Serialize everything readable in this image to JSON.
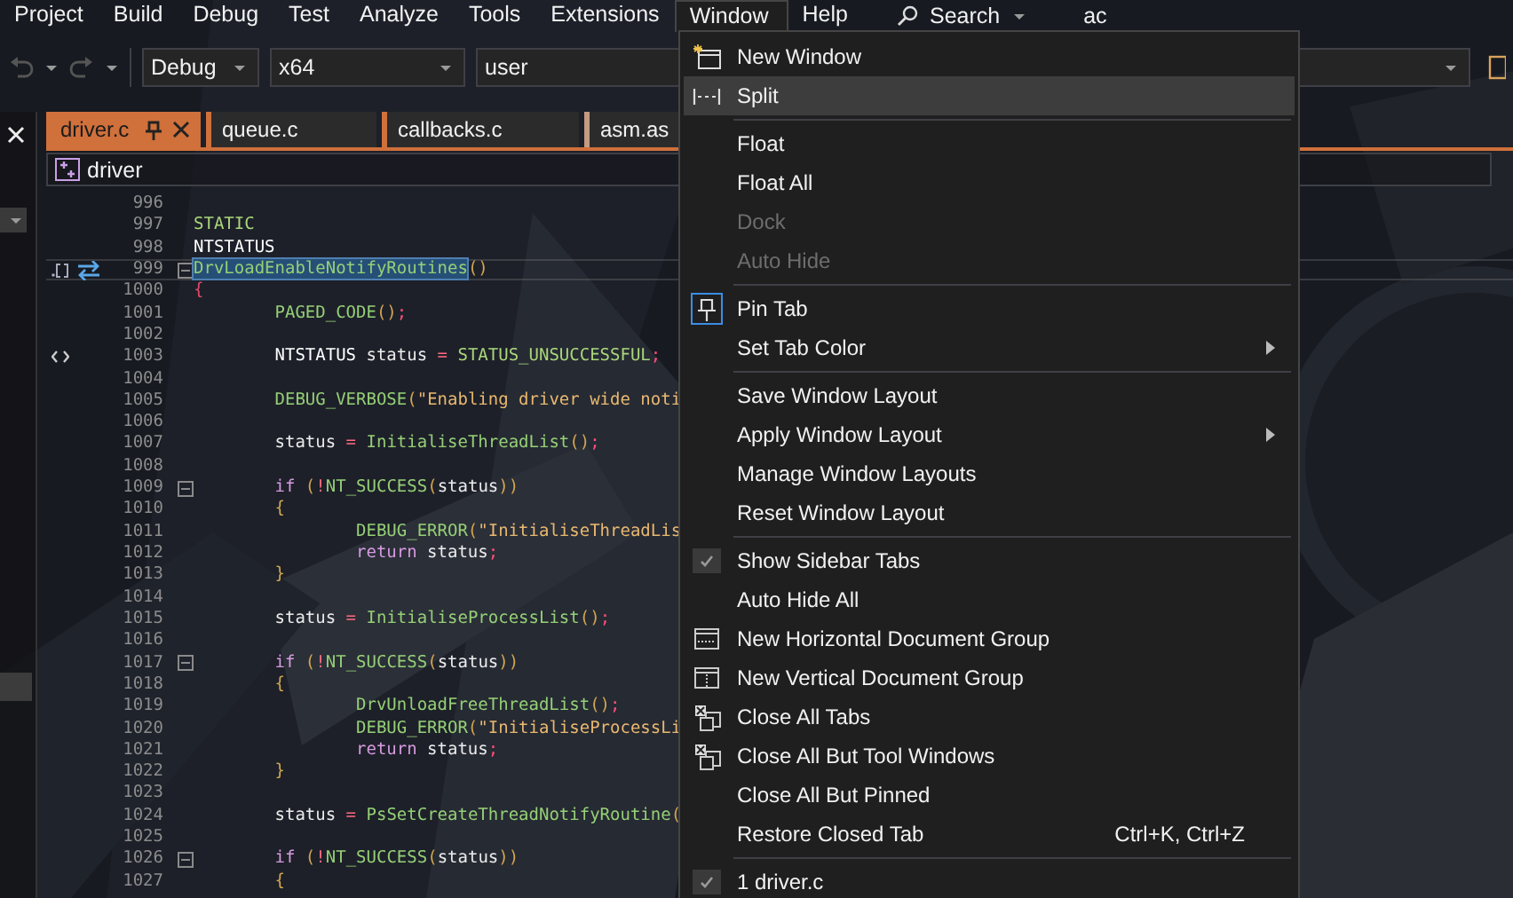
{
  "menu_bar": [
    {
      "label": "Project",
      "selected": false
    },
    {
      "label": "Build",
      "selected": false
    },
    {
      "label": "Debug",
      "selected": false
    },
    {
      "label": "Test",
      "selected": false
    },
    {
      "label": "Analyze",
      "selected": false
    },
    {
      "label": "Tools",
      "selected": false
    },
    {
      "label": "Extensions",
      "selected": false
    },
    {
      "label": "Window",
      "selected": true
    },
    {
      "label": "Help",
      "selected": false
    }
  ],
  "search": {
    "label": "Search"
  },
  "title": "ac",
  "toolbar": {
    "combos": [
      {
        "value": "Debug"
      },
      {
        "value": "x64"
      },
      {
        "value": "user"
      }
    ]
  },
  "tabs": [
    {
      "label": "driver.c",
      "selected": true,
      "pinned": true
    },
    {
      "label": "queue.c",
      "selected": false,
      "pinned": false
    },
    {
      "label": "callbacks.c",
      "selected": false,
      "pinned": false
    },
    {
      "label": "asm.as",
      "selected": false,
      "pinned": false
    }
  ],
  "breadcrumb": {
    "label": "driver"
  },
  "editor": {
    "lines": [
      {
        "number": "996",
        "selected": false,
        "fold": false
      },
      {
        "number": "997",
        "selected": false,
        "fold": false,
        "tokens": [
          {
            "kind": "macro",
            "text": "STATIC"
          }
        ]
      },
      {
        "number": "998",
        "selected": false,
        "fold": false,
        "tokens": [
          {
            "kind": "type",
            "text": "NTSTATUS"
          }
        ]
      },
      {
        "number": "999",
        "selected": true,
        "fold": true,
        "markers": [
          {
            "kind": "bracket"
          },
          {
            "kind": "swap"
          }
        ],
        "tokens": [
          {
            "kind": "fn",
            "text": "DrvLoadEnableNotifyRoutines"
          },
          {
            "kind": "paren",
            "text": "()"
          }
        ]
      },
      {
        "number": "1000",
        "selected": false,
        "fold": false,
        "tokens": [
          {
            "kind": "brace",
            "text": "{"
          }
        ],
        "children": [
          {
            "number": "1001",
            "selected": false,
            "fold": false,
            "tokens": [
              {
                "kind": "fn",
                "text": "PAGED_CODE"
              },
              {
                "kind": "paren",
                "text": "()"
              },
              {
                "kind": "punct",
                "text": ";"
              }
            ]
          },
          {
            "number": "1002",
            "selected": false,
            "fold": false
          },
          {
            "number": "1003",
            "selected": false,
            "fold": false,
            "markers": [
              {
                "kind": "code"
              }
            ],
            "tokens": [
              {
                "kind": "type",
                "text": "NTSTATUS"
              },
              {
                "kind": "var",
                "text": " status "
              },
              {
                "kind": "op",
                "text": "= "
              },
              {
                "kind": "macro",
                "text": "STATUS_UNSUCCESSFUL"
              },
              {
                "kind": "punct",
                "text": ";"
              }
            ]
          },
          {
            "number": "1004",
            "selected": false,
            "fold": false
          },
          {
            "number": "1005",
            "selected": false,
            "fold": false,
            "tokens": [
              {
                "kind": "fn",
                "text": "DEBUG_VERBOSE"
              },
              {
                "kind": "paren",
                "text": "("
              },
              {
                "kind": "str",
                "text": "\"Enabling driver wide noti"
              }
            ]
          },
          {
            "number": "1006",
            "selected": false,
            "fold": false
          },
          {
            "number": "1007",
            "selected": false,
            "fold": false,
            "tokens": [
              {
                "kind": "var",
                "text": "status "
              },
              {
                "kind": "op",
                "text": "= "
              },
              {
                "kind": "fn",
                "text": "InitialiseThreadList"
              },
              {
                "kind": "paren",
                "text": "()"
              },
              {
                "kind": "punct",
                "text": ";"
              }
            ]
          },
          {
            "number": "1008",
            "selected": false,
            "fold": false
          },
          {
            "number": "1009",
            "selected": false,
            "fold": true,
            "tokens": [
              {
                "kind": "kw",
                "text": "if "
              },
              {
                "kind": "paren",
                "text": "("
              },
              {
                "kind": "op",
                "text": "!"
              },
              {
                "kind": "fn",
                "text": "NT_SUCCESS"
              },
              {
                "kind": "paren",
                "text": "("
              },
              {
                "kind": "var",
                "text": "status"
              },
              {
                "kind": "paren",
                "text": "))"
              }
            ]
          },
          {
            "number": "1010",
            "selected": false,
            "fold": false,
            "tokens": [
              {
                "kind": "paren",
                "text": "{"
              }
            ],
            "children": [
              {
                "number": "1011",
                "selected": false,
                "fold": false,
                "tokens": [
                  {
                    "kind": "fn",
                    "text": "DEBUG_ERROR"
                  },
                  {
                    "kind": "paren",
                    "text": "("
                  },
                  {
                    "kind": "str",
                    "text": "\"InitialiseThreadLis"
                  }
                ]
              },
              {
                "number": "1012",
                "selected": false,
                "fold": false,
                "tokens": [
                  {
                    "kind": "kw",
                    "text": "return"
                  },
                  {
                    "kind": "var",
                    "text": " status"
                  },
                  {
                    "kind": "punct",
                    "text": ";"
                  }
                ]
              }
            ]
          },
          {
            "number": "1013",
            "selected": false,
            "fold": false,
            "tokens": [
              {
                "kind": "paren",
                "text": "}"
              }
            ]
          },
          {
            "number": "1014",
            "selected": false,
            "fold": false
          },
          {
            "number": "1015",
            "selected": false,
            "fold": false,
            "tokens": [
              {
                "kind": "var",
                "text": "status "
              },
              {
                "kind": "op",
                "text": "= "
              },
              {
                "kind": "fn",
                "text": "InitialiseProcessList"
              },
              {
                "kind": "paren",
                "text": "()"
              },
              {
                "kind": "punct",
                "text": ";"
              }
            ]
          },
          {
            "number": "1016",
            "selected": false,
            "fold": false
          },
          {
            "number": "1017",
            "selected": false,
            "fold": true,
            "tokens": [
              {
                "kind": "kw",
                "text": "if "
              },
              {
                "kind": "paren",
                "text": "("
              },
              {
                "kind": "op",
                "text": "!"
              },
              {
                "kind": "fn",
                "text": "NT_SUCCESS"
              },
              {
                "kind": "paren",
                "text": "("
              },
              {
                "kind": "var",
                "text": "status"
              },
              {
                "kind": "paren",
                "text": "))"
              }
            ]
          },
          {
            "number": "1018",
            "selected": false,
            "fold": false,
            "tokens": [
              {
                "kind": "paren",
                "text": "{"
              }
            ],
            "children": [
              {
                "number": "1019",
                "selected": false,
                "fold": false,
                "tokens": [
                  {
                    "kind": "fn",
                    "text": "DrvUnloadFreeThreadList"
                  },
                  {
                    "kind": "paren",
                    "text": "()"
                  },
                  {
                    "kind": "punct",
                    "text": ";"
                  }
                ]
              },
              {
                "number": "1020",
                "selected": false,
                "fold": false,
                "tokens": [
                  {
                    "kind": "fn",
                    "text": "DEBUG_ERROR"
                  },
                  {
                    "kind": "paren",
                    "text": "("
                  },
                  {
                    "kind": "str",
                    "text": "\"InitialiseProcessLi"
                  }
                ]
              },
              {
                "number": "1021",
                "selected": false,
                "fold": false,
                "tokens": [
                  {
                    "kind": "kw",
                    "text": "return"
                  },
                  {
                    "kind": "var",
                    "text": " status"
                  },
                  {
                    "kind": "punct",
                    "text": ";"
                  }
                ]
              }
            ]
          },
          {
            "number": "1022",
            "selected": false,
            "fold": false,
            "tokens": [
              {
                "kind": "paren",
                "text": "}"
              }
            ]
          },
          {
            "number": "1023",
            "selected": false,
            "fold": false
          },
          {
            "number": "1024",
            "selected": false,
            "fold": false,
            "tokens": [
              {
                "kind": "var",
                "text": "status "
              },
              {
                "kind": "op",
                "text": "= "
              },
              {
                "kind": "fn",
                "text": "PsSetCreateThreadNotifyRoutine"
              },
              {
                "kind": "paren",
                "text": "("
              }
            ]
          },
          {
            "number": "1025",
            "selected": false,
            "fold": false
          },
          {
            "number": "1026",
            "selected": false,
            "fold": true,
            "tokens": [
              {
                "kind": "kw",
                "text": "if "
              },
              {
                "kind": "paren",
                "text": "("
              },
              {
                "kind": "op",
                "text": "!"
              },
              {
                "kind": "fn",
                "text": "NT_SUCCESS"
              },
              {
                "kind": "paren",
                "text": "("
              },
              {
                "kind": "var",
                "text": "status"
              },
              {
                "kind": "paren",
                "text": "))"
              }
            ]
          },
          {
            "number": "1027",
            "selected": false,
            "fold": false,
            "tokens": [
              {
                "kind": "paren",
                "text": "{"
              }
            ]
          }
        ]
      }
    ]
  },
  "window_menu": {
    "groups": [
      {
        "items": [
          {
            "label": "New Window",
            "kind": "window",
            "selected": false,
            "disabled": false,
            "checked": false,
            "submenu": false
          },
          {
            "label": "Split",
            "kind": "split",
            "selected": true,
            "disabled": false,
            "checked": false,
            "submenu": false
          }
        ]
      },
      {
        "items": [
          {
            "label": "Float",
            "kind": "plain",
            "selected": false,
            "disabled": false,
            "checked": false,
            "submenu": false
          },
          {
            "label": "Float All",
            "kind": "plain",
            "selected": false,
            "disabled": false,
            "checked": false,
            "submenu": false
          },
          {
            "label": "Dock",
            "kind": "plain",
            "selected": false,
            "disabled": true,
            "checked": false,
            "submenu": false
          },
          {
            "label": "Auto Hide",
            "kind": "plain",
            "selected": false,
            "disabled": true,
            "checked": false,
            "submenu": false
          }
        ]
      },
      {
        "items": [
          {
            "label": "Pin Tab",
            "kind": "pin",
            "selected": false,
            "disabled": false,
            "checked": true,
            "submenu": false
          },
          {
            "label": "Set Tab Color",
            "kind": "plain",
            "selected": false,
            "disabled": false,
            "checked": false,
            "submenu": true
          }
        ]
      },
      {
        "items": [
          {
            "label": "Save Window Layout",
            "kind": "plain",
            "selected": false,
            "disabled": false,
            "checked": false,
            "submenu": false
          },
          {
            "label": "Apply Window Layout",
            "kind": "plain",
            "selected": false,
            "disabled": false,
            "checked": false,
            "submenu": true
          },
          {
            "label": "Manage Window Layouts",
            "kind": "plain",
            "selected": false,
            "disabled": false,
            "checked": false,
            "submenu": false
          },
          {
            "label": "Reset Window Layout",
            "kind": "plain",
            "selected": false,
            "disabled": false,
            "checked": false,
            "submenu": false
          }
        ]
      },
      {
        "items": [
          {
            "label": "Show Sidebar Tabs",
            "kind": "plain",
            "selected": false,
            "disabled": false,
            "checked": true,
            "submenu": false
          },
          {
            "label": "Auto Hide All",
            "kind": "plain",
            "selected": false,
            "disabled": false,
            "checked": false,
            "submenu": false
          },
          {
            "label": "New Horizontal Document Group",
            "kind": "hsplit",
            "selected": false,
            "disabled": false,
            "checked": false,
            "submenu": false
          },
          {
            "label": "New Vertical Document Group",
            "kind": "vsplit",
            "selected": false,
            "disabled": false,
            "checked": false,
            "submenu": false
          },
          {
            "label": "Close All Tabs",
            "kind": "closer",
            "selected": false,
            "disabled": false,
            "checked": false,
            "submenu": false
          },
          {
            "label": "Close All But Tool Windows",
            "kind": "closer",
            "selected": false,
            "disabled": false,
            "checked": false,
            "submenu": false
          },
          {
            "label": "Close All But Pinned",
            "kind": "plain",
            "selected": false,
            "disabled": false,
            "checked": false,
            "submenu": false
          },
          {
            "label": "Restore Closed Tab",
            "kind": "plain",
            "shortcut": "Ctrl+K, Ctrl+Z",
            "selected": false,
            "disabled": false,
            "checked": false,
            "submenu": false
          }
        ]
      },
      {
        "items": [
          {
            "label": "1 driver.c",
            "kind": "plain",
            "selected": false,
            "disabled": false,
            "checked": true,
            "submenu": false
          }
        ]
      }
    ]
  }
}
